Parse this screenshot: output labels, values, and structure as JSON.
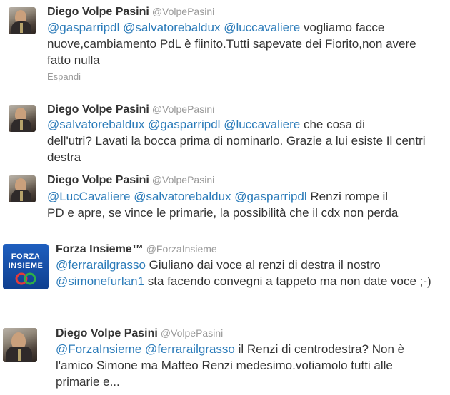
{
  "tweets": [
    {
      "name": "Diego Volpe Pasini",
      "handle": "@VolpePasini",
      "mentions": [
        "@gasparripdl",
        "@salvatorebaldux",
        "@luccavaliere"
      ],
      "text_line1_rest": "vogliamo facce",
      "text_line2": "nuove,cambiamento PdL è fiinito.Tutti sapevate dei Fiorito,non avere",
      "text_line3": "fatto nulla",
      "expand_label": "Espandi",
      "avatar_icon": "profile-photo-man-in-suit"
    },
    {
      "name": "Diego Volpe Pasini",
      "handle": "@VolpePasini",
      "mentions": [
        "@salvatorebaldux",
        "@gasparripdl",
        "@luccavaliere"
      ],
      "text_line1_rest": "che cosa di",
      "text_line2": "dell'utri? Lavati la bocca prima di nominarlo. Grazie a lui esiste Il centri",
      "text_line3": "destra",
      "avatar_icon": "profile-photo-man-in-suit"
    },
    {
      "name": "Diego Volpe Pasini",
      "handle": "@VolpePasini",
      "mentions": [
        "@LucCavaliere",
        "@salvatorebaldux",
        "@gasparripdl"
      ],
      "text_line1_rest": "Renzi rompe il",
      "text_line2": "PD e apre, se vince le primarie, la possibilità che il cdx non perda",
      "avatar_icon": "profile-photo-man-in-suit"
    },
    {
      "name": "Forza Insieme™",
      "handle": "@ForzaInsieme",
      "mention_a": "@ferrarailgrasso",
      "text_line1_rest": "Giuliano dai voce al renzi di destra il nostro",
      "mention_b": "@simonefurlan1",
      "text_line2_rest": "sta facendo convegni a tappeto ma non date voce ;-)",
      "avatar_word1": "FORZA",
      "avatar_word2": "INSIEME",
      "avatar_icon": "forza-insieme-logo"
    },
    {
      "name": "Diego Volpe Pasini",
      "handle": "@VolpePasini",
      "mentions": [
        "@ForzaInsieme",
        "@ferrarailgrasso"
      ],
      "text_line1_rest": "il Renzi di centrodestra? Non è",
      "text_line2": "l'amico Simone ma Matteo Renzi medesimo.votiamolo tutti alle",
      "text_line3": "primarie e...",
      "avatar_icon": "profile-photo-man-in-suit"
    }
  ],
  "colors": {
    "mention": "#2b7bb9",
    "name": "#333333",
    "handle": "#999999",
    "text": "#333333"
  }
}
